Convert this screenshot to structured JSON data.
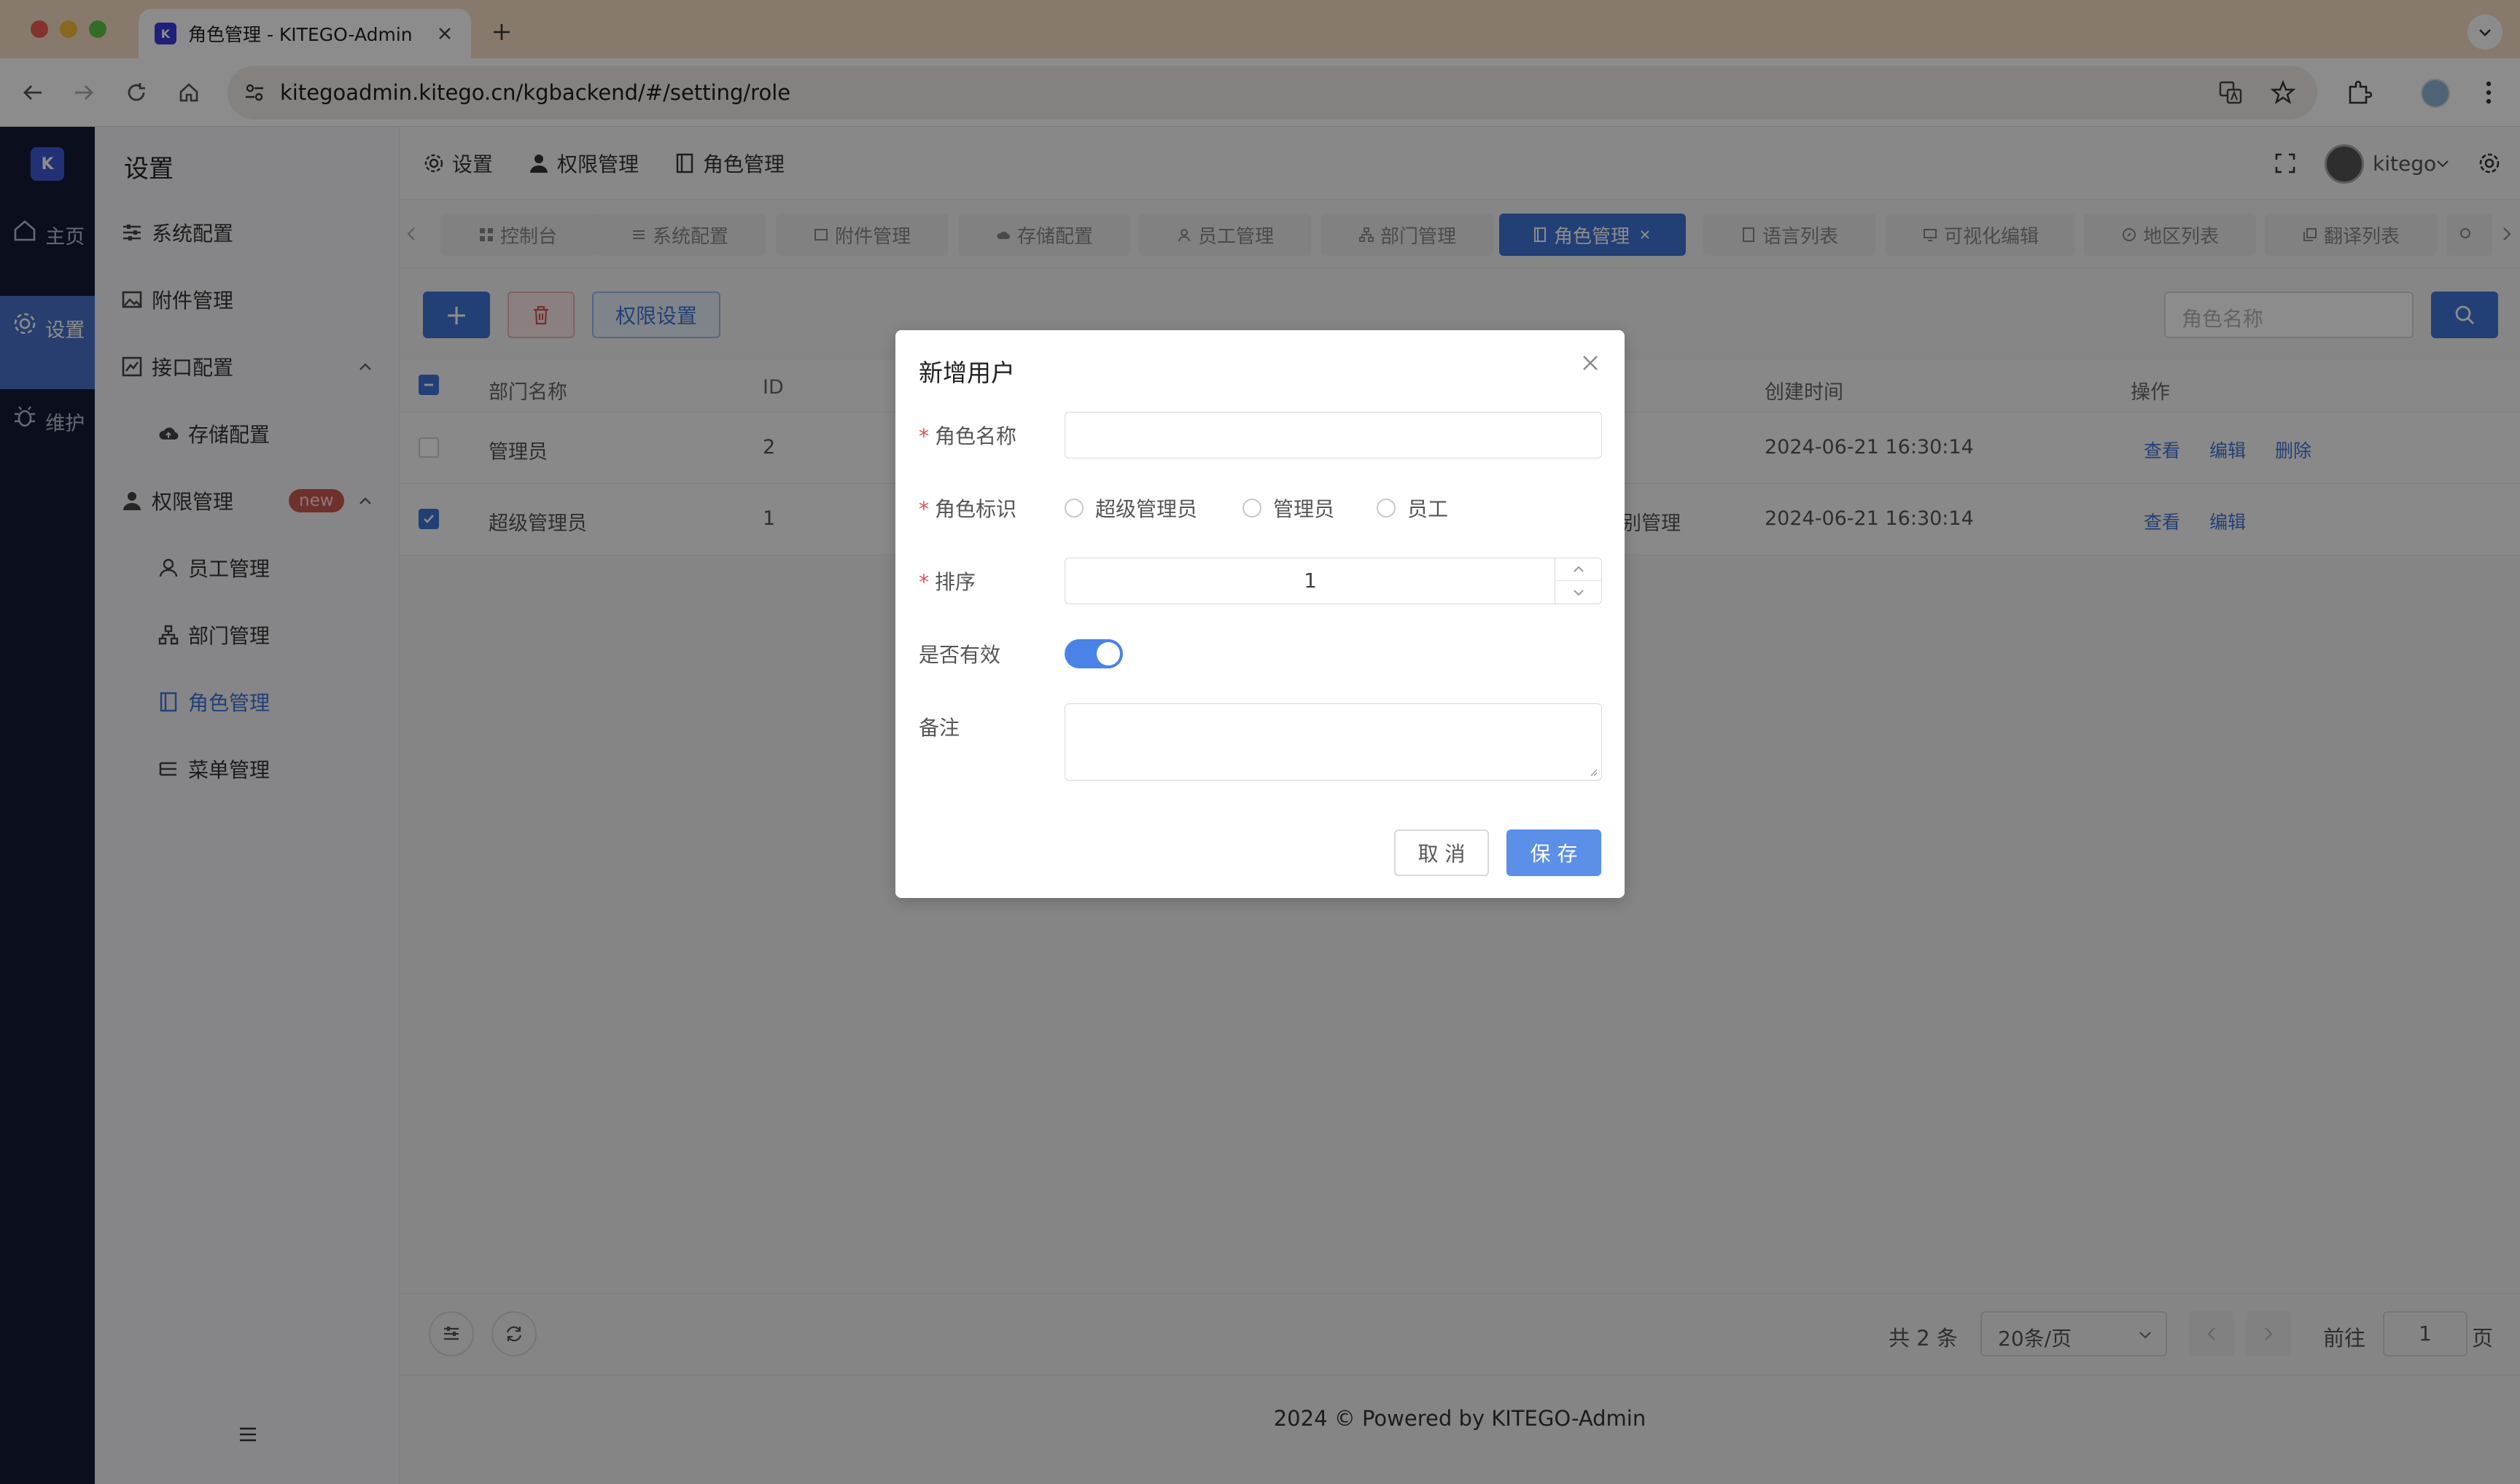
{
  "browser": {
    "tab_title": "角色管理 - KITEGO-Admin",
    "url": "kitegoadmin.kitego.cn/kgbackend/#/setting/role",
    "favicon_text": "K"
  },
  "rail": {
    "logo_text": "K",
    "items": [
      {
        "label": "主页",
        "icon": "home-icon"
      },
      {
        "label": "设置",
        "icon": "gear-icon"
      },
      {
        "label": "维护",
        "icon": "bug-icon"
      }
    ]
  },
  "sidebar": {
    "header": "设置",
    "items": [
      {
        "label": "系统配置",
        "icon": "sliders-icon"
      },
      {
        "label": "附件管理",
        "icon": "image-icon"
      },
      {
        "label": "接口配置",
        "icon": "chart-icon"
      },
      {
        "label": "存储配置",
        "icon": "cloud-upload-icon"
      },
      {
        "label": "权限管理",
        "icon": "user-icon",
        "badge": "new"
      },
      {
        "label": "员工管理",
        "icon": "person-icon"
      },
      {
        "label": "部门管理",
        "icon": "org-icon"
      },
      {
        "label": "角色管理",
        "icon": "role-icon"
      },
      {
        "label": "菜单管理",
        "icon": "list-icon"
      }
    ]
  },
  "breadcrumb": [
    "设置",
    "权限管理",
    "角色管理"
  ],
  "header": {
    "username": "kitego"
  },
  "page_tabs": [
    "控制台",
    "系统配置",
    "附件管理",
    "存储配置",
    "员工管理",
    "部门管理",
    "角色管理",
    "语言列表",
    "可视化编辑",
    "地区列表",
    "翻译列表"
  ],
  "toolbar": {
    "add_label": "+",
    "permission_label": "权限设置",
    "search_placeholder": "角色名称"
  },
  "table": {
    "columns": {
      "name": "部门名称",
      "id": "ID",
      "created": "创建时间",
      "action": "操作"
    },
    "rows": [
      {
        "name": "管理员",
        "id": "2",
        "extra": "",
        "created": "2024-06-21 16:30:14",
        "checked": false,
        "actions": [
          "查看",
          "编辑",
          "删除"
        ]
      },
      {
        "name": "超级管理员",
        "id": "1",
        "extra": "别管理",
        "created": "2024-06-21 16:30:14",
        "checked": true,
        "actions": [
          "查看",
          "编辑"
        ]
      }
    ]
  },
  "pagination": {
    "total": "共 2 条",
    "page_size": "20条/页",
    "goto_label": "前往",
    "page": "1",
    "page_suffix": "页"
  },
  "footer": {
    "copyright": "2024 © Powered by  KITEGO-Admin"
  },
  "modal": {
    "title": "新增用户",
    "fields": {
      "role_name": {
        "label": "角色名称",
        "value": ""
      },
      "role_key": {
        "label": "角色标识",
        "options": [
          "超级管理员",
          "管理员",
          "员工"
        ]
      },
      "sort": {
        "label": "排序",
        "value": "1"
      },
      "active": {
        "label": "是否有效",
        "on": true
      },
      "remark": {
        "label": "备注",
        "value": ""
      }
    },
    "cancel_label": "取 消",
    "save_label": "保 存"
  },
  "colors": {
    "accent": "#3f75d6",
    "rail": "#141a33",
    "danger": "#e05050",
    "badge": "#c95a51"
  }
}
